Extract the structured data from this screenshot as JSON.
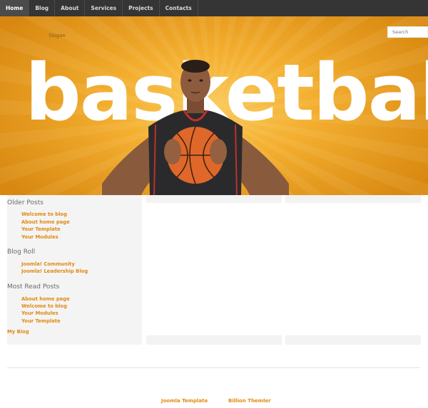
{
  "nav": {
    "items": [
      {
        "label": "Home",
        "active": true
      },
      {
        "label": "Blog"
      },
      {
        "label": "About"
      },
      {
        "label": "Services"
      },
      {
        "label": "Projects"
      },
      {
        "label": "Contacts"
      }
    ]
  },
  "header": {
    "slogan": "Slogan",
    "search_placeholder": "Search",
    "hero_text": "basketball"
  },
  "sidebar": {
    "older_posts": {
      "title": "Older Posts",
      "links": [
        "Welcome to blog",
        "About home page",
        "Your Template",
        "Your Modules"
      ]
    },
    "blog_roll": {
      "title": "Blog Roll",
      "links": [
        "Joomla! Community",
        "Joomla! Leadership Blog"
      ]
    },
    "most_read": {
      "title": "Most Read Posts",
      "links": [
        "About home page",
        "Welcome to blog",
        "Your Modules",
        "Your Template"
      ]
    },
    "my_blog": "My Blog"
  },
  "footer": {
    "links": [
      "Joomla Template",
      "Billion Themler"
    ]
  },
  "colors": {
    "nav_bg": "#353535",
    "accent": "#e08a12",
    "hero_orange": "#f3ae2f"
  }
}
